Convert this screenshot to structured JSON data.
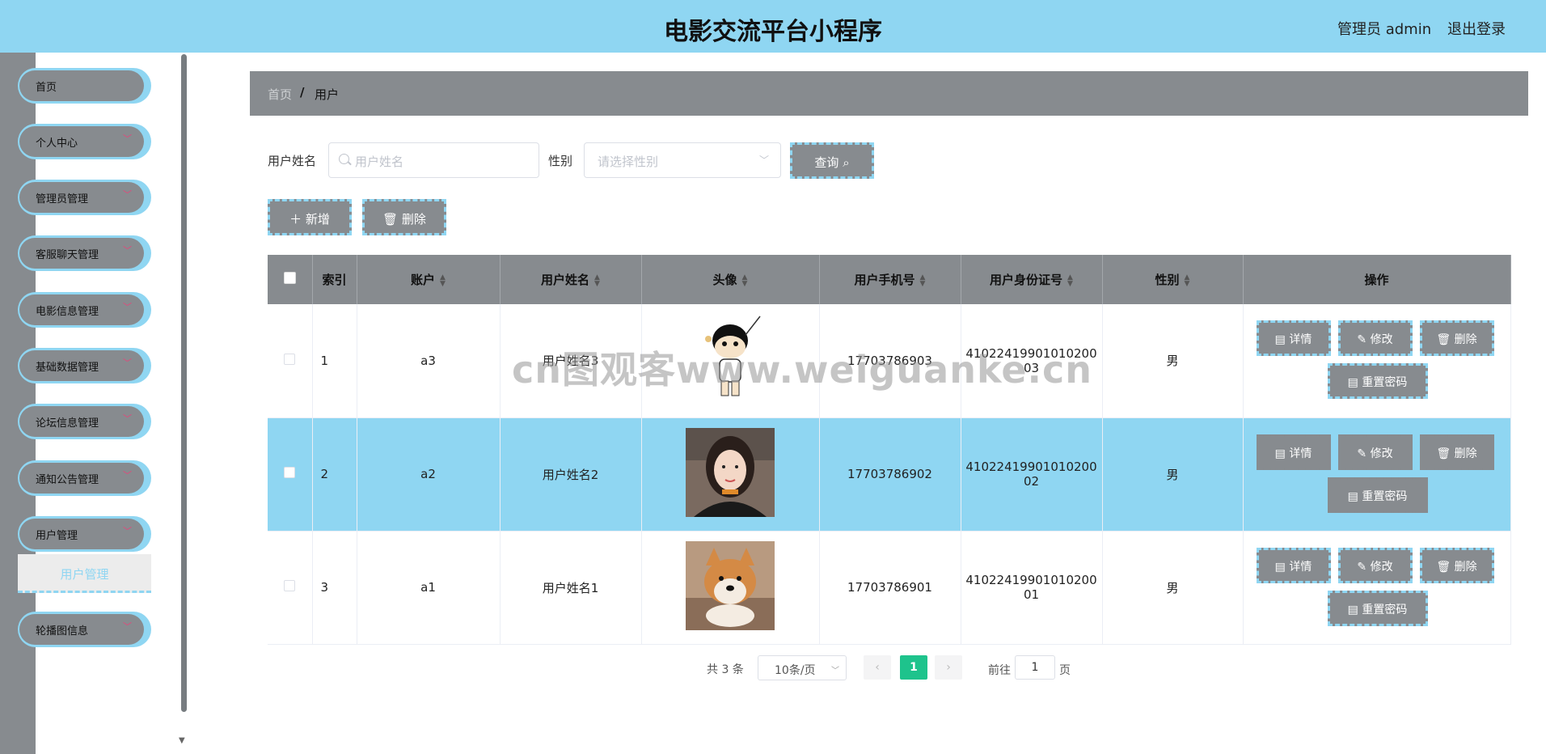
{
  "header": {
    "title": "电影交流平台小程序",
    "user": "管理员 admin",
    "logout": "退出登录"
  },
  "sidebar": {
    "items": [
      {
        "label": "首页",
        "has_children": false
      },
      {
        "label": "个人中心",
        "has_children": true
      },
      {
        "label": "管理员管理",
        "has_children": true
      },
      {
        "label": "客服聊天管理",
        "has_children": true
      },
      {
        "label": "电影信息管理",
        "has_children": true
      },
      {
        "label": "基础数据管理",
        "has_children": true
      },
      {
        "label": "论坛信息管理",
        "has_children": true
      },
      {
        "label": "通知公告管理",
        "has_children": true
      },
      {
        "label": "用户管理",
        "has_children": true
      },
      {
        "label": "轮播图信息",
        "has_children": true
      }
    ],
    "active_sub": "用户管理"
  },
  "breadcrumb": {
    "home": "首页",
    "separator": "/",
    "current": "用户"
  },
  "search": {
    "name_label": "用户姓名",
    "name_placeholder": "用户姓名",
    "gender_label": "性别",
    "gender_placeholder": "请选择性别",
    "query_button": "查询"
  },
  "actions": {
    "add": "新增",
    "delete": "删除"
  },
  "table": {
    "columns": [
      "索引",
      "账户",
      "用户姓名",
      "头像",
      "用户手机号",
      "用户身份证号",
      "性别",
      "操作"
    ],
    "rows": [
      {
        "index": "1",
        "account": "a3",
        "name": "用户姓名3",
        "phone": "17703786903",
        "id_line1": "41022419901010200",
        "id_line2": "03",
        "gender": "男",
        "avatar": "cartoon-boy"
      },
      {
        "index": "2",
        "account": "a2",
        "name": "用户姓名2",
        "phone": "17703786902",
        "id_line1": "41022419901010200",
        "id_line2": "02",
        "gender": "男",
        "avatar": "girl-photo"
      },
      {
        "index": "3",
        "account": "a1",
        "name": "用户姓名1",
        "phone": "17703786901",
        "id_line1": "41022419901010200",
        "id_line2": "01",
        "gender": "男",
        "avatar": "dog-photo"
      }
    ],
    "ops": {
      "detail": "详情",
      "edit": "修改",
      "remove": "删除",
      "reset": "重置密码"
    }
  },
  "watermark": "cn图观客www.weiguanke.cn",
  "pagination": {
    "total": "共 3 条",
    "page_size": "10条/页",
    "current": "1",
    "goto": "前往",
    "goto_value": "1",
    "unit": "页"
  },
  "colors": {
    "accent": "#8fd6f2",
    "gray": "#878b8f",
    "page_active": "#1ec38c"
  }
}
